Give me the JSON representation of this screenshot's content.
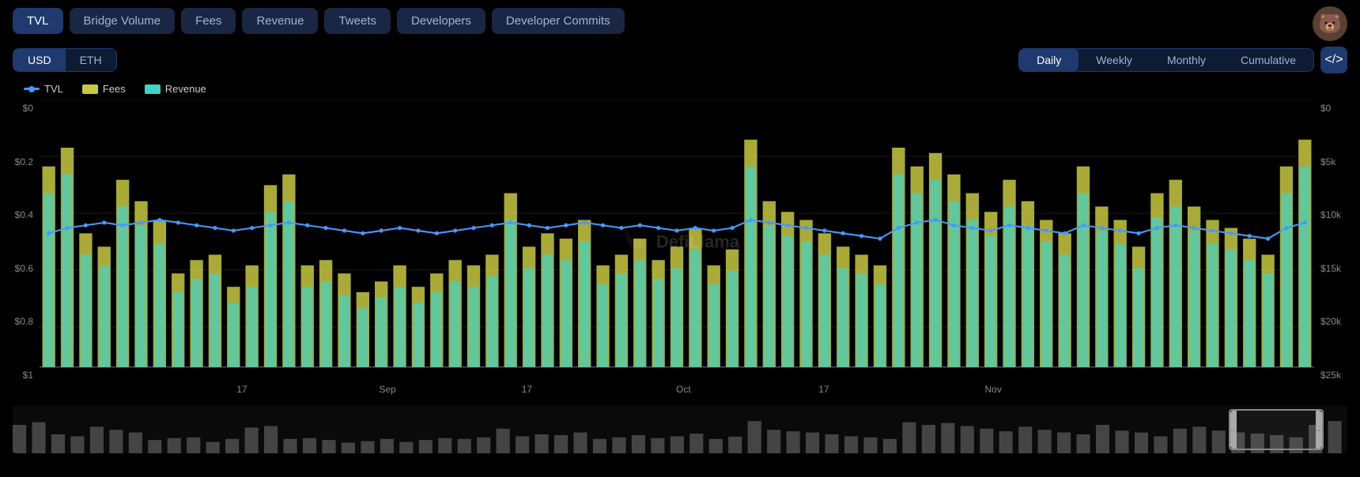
{
  "nav": {
    "buttons": [
      {
        "label": "TVL",
        "active": true
      },
      {
        "label": "Bridge Volume",
        "active": false
      },
      {
        "label": "Fees",
        "active": false
      },
      {
        "label": "Revenue",
        "active": false
      },
      {
        "label": "Tweets",
        "active": false
      },
      {
        "label": "Developers",
        "active": false
      },
      {
        "label": "Developer Commits",
        "active": false
      }
    ]
  },
  "currency": {
    "options": [
      {
        "label": "USD",
        "active": true
      },
      {
        "label": "ETH",
        "active": false
      }
    ]
  },
  "period": {
    "options": [
      {
        "label": "Daily",
        "active": true
      },
      {
        "label": "Weekly",
        "active": false
      },
      {
        "label": "Monthly",
        "active": false
      },
      {
        "label": "Cumulative",
        "active": false
      }
    ]
  },
  "code_btn_label": "</>",
  "legend": [
    {
      "type": "dot",
      "color": "#4499ff",
      "label": "TVL"
    },
    {
      "type": "rect",
      "color": "#c8c840",
      "label": "Fees"
    },
    {
      "type": "rect",
      "color": "#40d4c8",
      "label": "Revenue"
    }
  ],
  "y_axis_left": [
    "$0",
    "$0.2",
    "$0.4",
    "$0.6",
    "$0.8",
    "$1"
  ],
  "y_axis_right": [
    "$0",
    "$5k",
    "$10k",
    "$15k",
    "$20k",
    "$25k"
  ],
  "x_labels": [
    {
      "label": "17",
      "pct": 13
    },
    {
      "label": "Sep",
      "pct": 25
    },
    {
      "label": "17",
      "pct": 38
    },
    {
      "label": "Oct",
      "pct": 51
    },
    {
      "label": "17",
      "pct": 63
    },
    {
      "label": "Nov",
      "pct": 77
    }
  ],
  "watermark": "DefiLlama",
  "chart": {
    "bars": [
      {
        "x": 1,
        "fees": 0.75,
        "revenue": 0.65
      },
      {
        "x": 2,
        "fees": 0.82,
        "revenue": 0.72
      },
      {
        "x": 3,
        "fees": 0.5,
        "revenue": 0.42
      },
      {
        "x": 4,
        "fees": 0.45,
        "revenue": 0.38
      },
      {
        "x": 5,
        "fees": 0.7,
        "revenue": 0.6
      },
      {
        "x": 6,
        "fees": 0.62,
        "revenue": 0.53
      },
      {
        "x": 7,
        "fees": 0.55,
        "revenue": 0.46
      },
      {
        "x": 8,
        "fees": 0.35,
        "revenue": 0.28
      },
      {
        "x": 9,
        "fees": 0.4,
        "revenue": 0.33
      },
      {
        "x": 10,
        "fees": 0.42,
        "revenue": 0.35
      },
      {
        "x": 11,
        "fees": 0.3,
        "revenue": 0.24
      },
      {
        "x": 12,
        "fees": 0.38,
        "revenue": 0.3
      },
      {
        "x": 13,
        "fees": 0.68,
        "revenue": 0.58
      },
      {
        "x": 14,
        "fees": 0.72,
        "revenue": 0.62
      },
      {
        "x": 15,
        "fees": 0.38,
        "revenue": 0.3
      },
      {
        "x": 16,
        "fees": 0.4,
        "revenue": 0.32
      },
      {
        "x": 17,
        "fees": 0.35,
        "revenue": 0.27
      },
      {
        "x": 18,
        "fees": 0.28,
        "revenue": 0.22
      },
      {
        "x": 19,
        "fees": 0.32,
        "revenue": 0.26
      },
      {
        "x": 20,
        "fees": 0.38,
        "revenue": 0.3
      },
      {
        "x": 21,
        "fees": 0.3,
        "revenue": 0.24
      },
      {
        "x": 22,
        "fees": 0.35,
        "revenue": 0.28
      },
      {
        "x": 23,
        "fees": 0.4,
        "revenue": 0.32
      },
      {
        "x": 24,
        "fees": 0.38,
        "revenue": 0.3
      },
      {
        "x": 25,
        "fees": 0.42,
        "revenue": 0.34
      },
      {
        "x": 26,
        "fees": 0.65,
        "revenue": 0.55
      },
      {
        "x": 27,
        "fees": 0.45,
        "revenue": 0.37
      },
      {
        "x": 28,
        "fees": 0.5,
        "revenue": 0.42
      },
      {
        "x": 29,
        "fees": 0.48,
        "revenue": 0.4
      },
      {
        "x": 30,
        "fees": 0.55,
        "revenue": 0.47
      },
      {
        "x": 31,
        "fees": 0.38,
        "revenue": 0.31
      },
      {
        "x": 32,
        "fees": 0.42,
        "revenue": 0.35
      },
      {
        "x": 33,
        "fees": 0.48,
        "revenue": 0.4
      },
      {
        "x": 34,
        "fees": 0.4,
        "revenue": 0.33
      },
      {
        "x": 35,
        "fees": 0.45,
        "revenue": 0.37
      },
      {
        "x": 36,
        "fees": 0.52,
        "revenue": 0.44
      },
      {
        "x": 37,
        "fees": 0.38,
        "revenue": 0.31
      },
      {
        "x": 38,
        "fees": 0.44,
        "revenue": 0.36
      },
      {
        "x": 39,
        "fees": 0.85,
        "revenue": 0.75
      },
      {
        "x": 40,
        "fees": 0.62,
        "revenue": 0.53
      },
      {
        "x": 41,
        "fees": 0.58,
        "revenue": 0.49
      },
      {
        "x": 42,
        "fees": 0.55,
        "revenue": 0.47
      },
      {
        "x": 43,
        "fees": 0.5,
        "revenue": 0.42
      },
      {
        "x": 44,
        "fees": 0.45,
        "revenue": 0.37
      },
      {
        "x": 45,
        "fees": 0.42,
        "revenue": 0.35
      },
      {
        "x": 46,
        "fees": 0.38,
        "revenue": 0.31
      },
      {
        "x": 47,
        "fees": 0.82,
        "revenue": 0.72
      },
      {
        "x": 48,
        "fees": 0.75,
        "revenue": 0.65
      },
      {
        "x": 49,
        "fees": 0.8,
        "revenue": 0.7
      },
      {
        "x": 50,
        "fees": 0.72,
        "revenue": 0.62
      },
      {
        "x": 51,
        "fees": 0.65,
        "revenue": 0.55
      },
      {
        "x": 52,
        "fees": 0.58,
        "revenue": 0.49
      },
      {
        "x": 53,
        "fees": 0.7,
        "revenue": 0.6
      },
      {
        "x": 54,
        "fees": 0.62,
        "revenue": 0.53
      },
      {
        "x": 55,
        "fees": 0.55,
        "revenue": 0.47
      },
      {
        "x": 56,
        "fees": 0.5,
        "revenue": 0.42
      },
      {
        "x": 57,
        "fees": 0.75,
        "revenue": 0.65
      },
      {
        "x": 58,
        "fees": 0.6,
        "revenue": 0.51
      },
      {
        "x": 59,
        "fees": 0.55,
        "revenue": 0.46
      },
      {
        "x": 60,
        "fees": 0.45,
        "revenue": 0.37
      },
      {
        "x": 61,
        "fees": 0.65,
        "revenue": 0.56
      },
      {
        "x": 62,
        "fees": 0.7,
        "revenue": 0.6
      },
      {
        "x": 63,
        "fees": 0.6,
        "revenue": 0.51
      },
      {
        "x": 64,
        "fees": 0.55,
        "revenue": 0.46
      },
      {
        "x": 65,
        "fees": 0.52,
        "revenue": 0.44
      },
      {
        "x": 66,
        "fees": 0.48,
        "revenue": 0.4
      },
      {
        "x": 67,
        "fees": 0.42,
        "revenue": 0.35
      },
      {
        "x": 68,
        "fees": 0.75,
        "revenue": 0.65
      },
      {
        "x": 69,
        "fees": 0.85,
        "revenue": 0.75
      }
    ],
    "tvl_line": [
      0.5,
      0.52,
      0.53,
      0.54,
      0.53,
      0.54,
      0.55,
      0.54,
      0.53,
      0.52,
      0.51,
      0.52,
      0.53,
      0.54,
      0.53,
      0.52,
      0.51,
      0.5,
      0.51,
      0.52,
      0.51,
      0.5,
      0.51,
      0.52,
      0.53,
      0.54,
      0.53,
      0.52,
      0.53,
      0.54,
      0.53,
      0.52,
      0.53,
      0.52,
      0.51,
      0.52,
      0.51,
      0.52,
      0.55,
      0.54,
      0.53,
      0.52,
      0.51,
      0.5,
      0.49,
      0.48,
      0.52,
      0.54,
      0.55,
      0.53,
      0.52,
      0.51,
      0.53,
      0.52,
      0.51,
      0.5,
      0.53,
      0.52,
      0.51,
      0.5,
      0.52,
      0.53,
      0.52,
      0.51,
      0.5,
      0.49,
      0.48,
      0.52,
      0.54
    ]
  }
}
